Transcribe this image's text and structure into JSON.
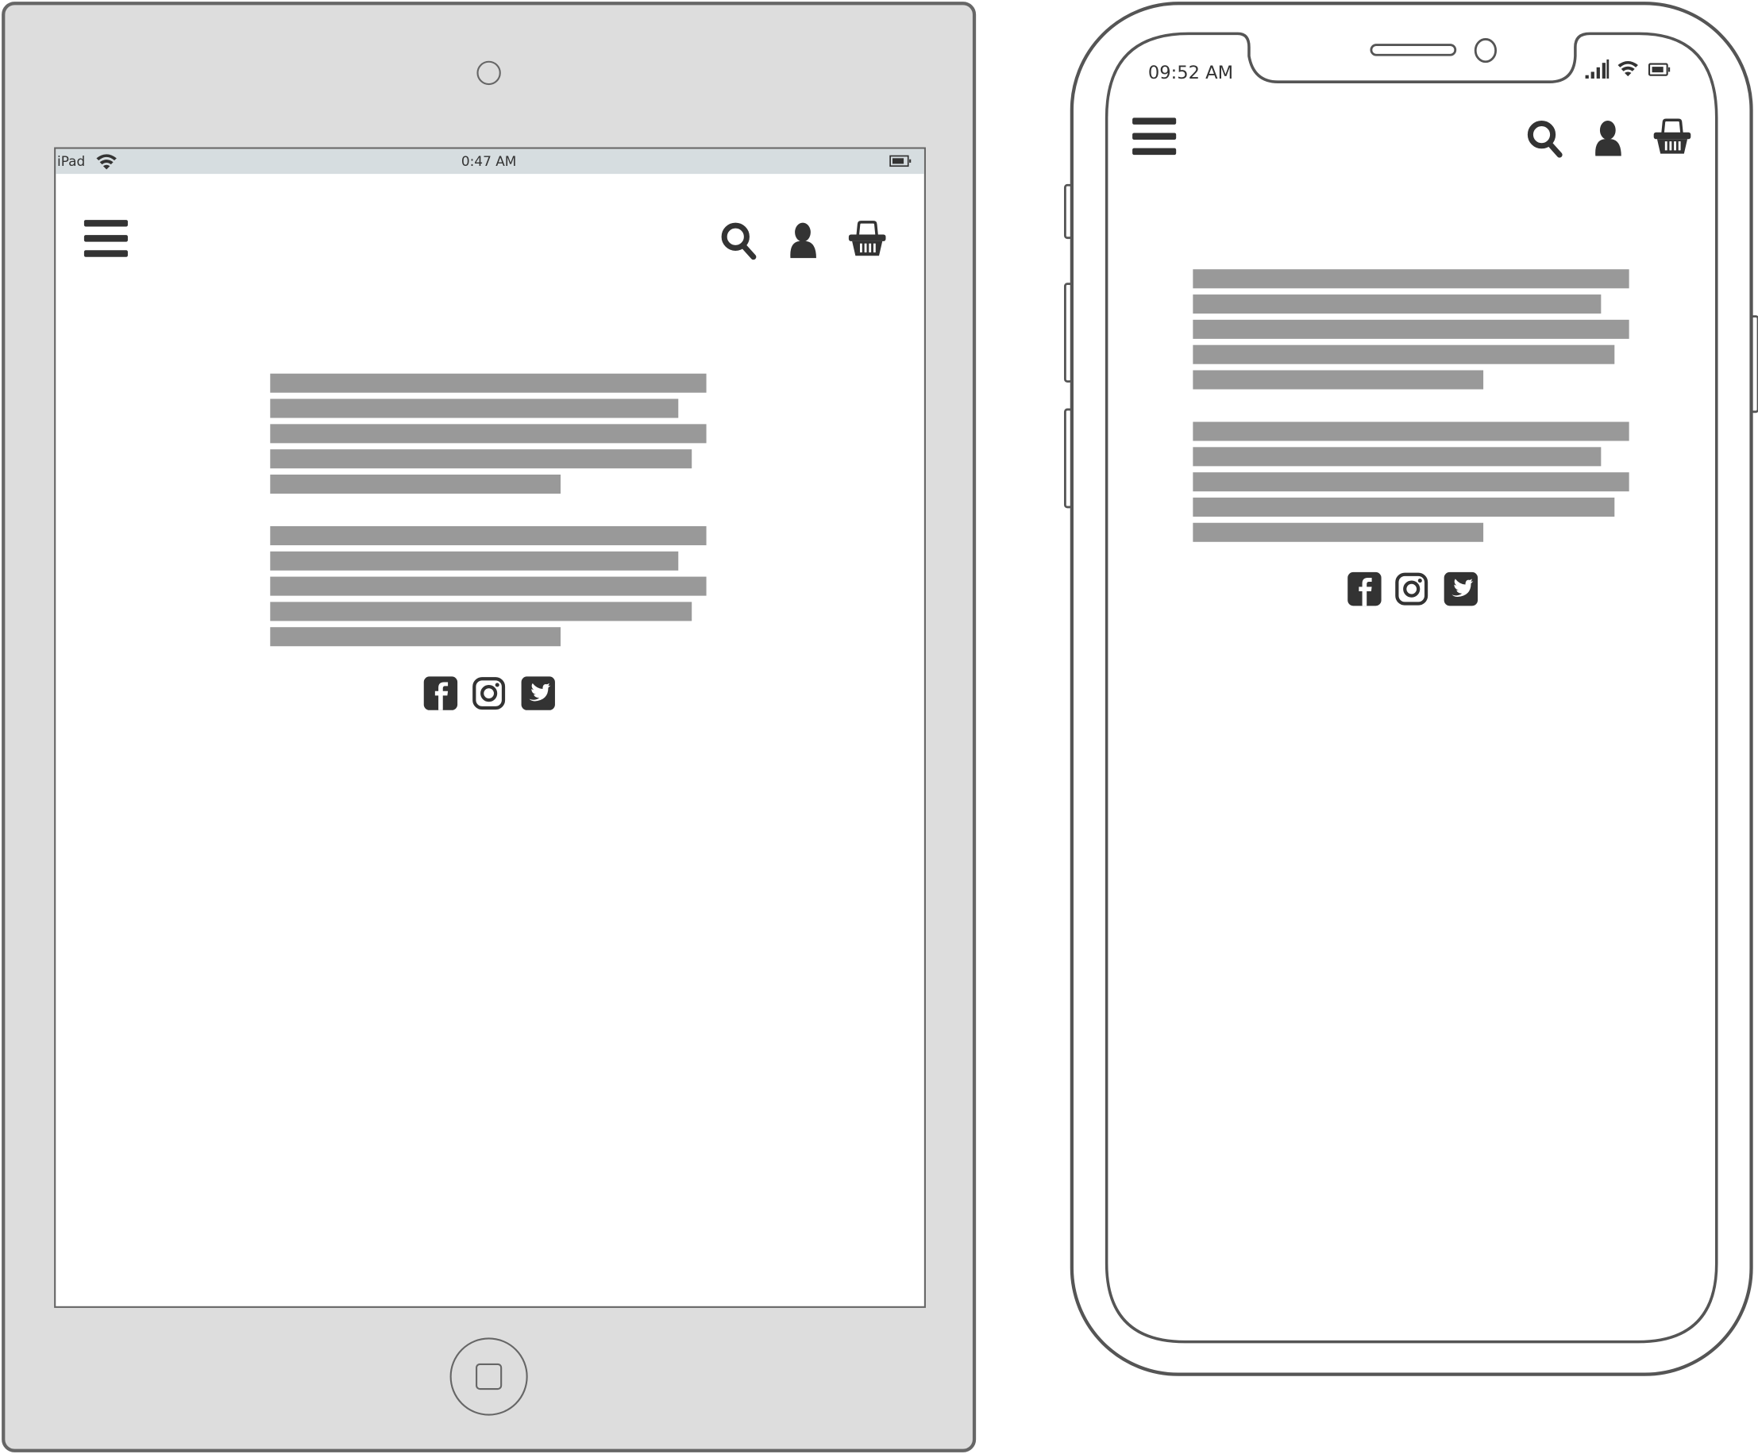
{
  "colors": {
    "frame": "#666666",
    "ipad_body": "#dddddd",
    "status_bar": "#d6dde0",
    "icon": "#333333",
    "text_bar": "#999999"
  },
  "ipad": {
    "status": {
      "device_label": "iPad",
      "time": "0:47 AM",
      "icons": [
        "wifi-icon",
        "battery-icon"
      ]
    },
    "header_icons": [
      "hamburger-menu-icon",
      "search-icon",
      "user-icon",
      "basket-icon"
    ],
    "social_icons": [
      "facebook-icon",
      "instagram-icon",
      "twitter-icon"
    ]
  },
  "iphone": {
    "status": {
      "time": "09:52 AM",
      "icons": [
        "signal-icon",
        "wifi-icon",
        "battery-icon"
      ]
    },
    "header_icons": [
      "hamburger-menu-icon",
      "search-icon",
      "user-icon",
      "basket-icon"
    ],
    "social_icons": [
      "facebook-icon",
      "instagram-icon",
      "twitter-icon"
    ]
  }
}
